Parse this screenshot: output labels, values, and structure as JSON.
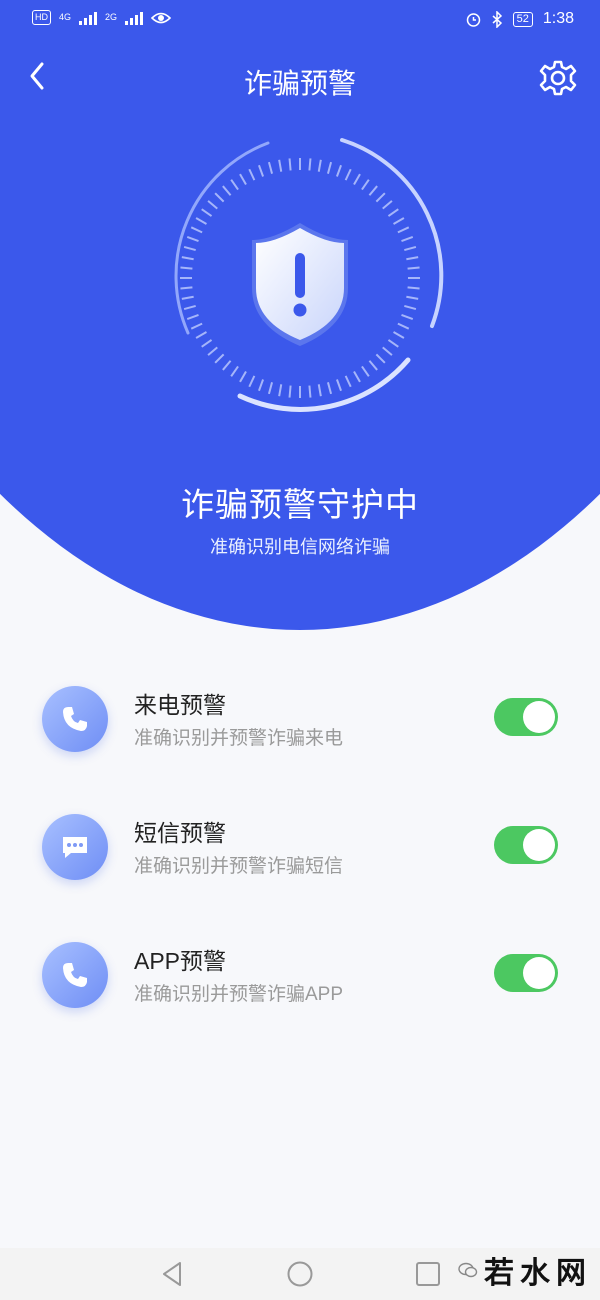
{
  "status_bar": {
    "hd_badge": "HD",
    "sim1_network": "4G",
    "sim2_network": "2G",
    "battery": "52",
    "time": "1:38"
  },
  "nav": {
    "title": "诈骗预警"
  },
  "hero": {
    "status_title": "诈骗预警守护中",
    "status_subtitle": "准确识别电信网络诈骗"
  },
  "settings": [
    {
      "title": "来电预警",
      "desc": "准确识别并预警诈骗来电",
      "icon": "phone-icon",
      "enabled": true
    },
    {
      "title": "短信预警",
      "desc": "准确识别并预警诈骗短信",
      "icon": "message-icon",
      "enabled": true
    },
    {
      "title": "APP预警",
      "desc": "准确识别并预警诈骗APP",
      "icon": "phone-icon",
      "enabled": true
    }
  ],
  "watermark": {
    "text": "若水网"
  },
  "colors": {
    "primary": "#3b58eb",
    "toggle_on": "#4cc861"
  }
}
